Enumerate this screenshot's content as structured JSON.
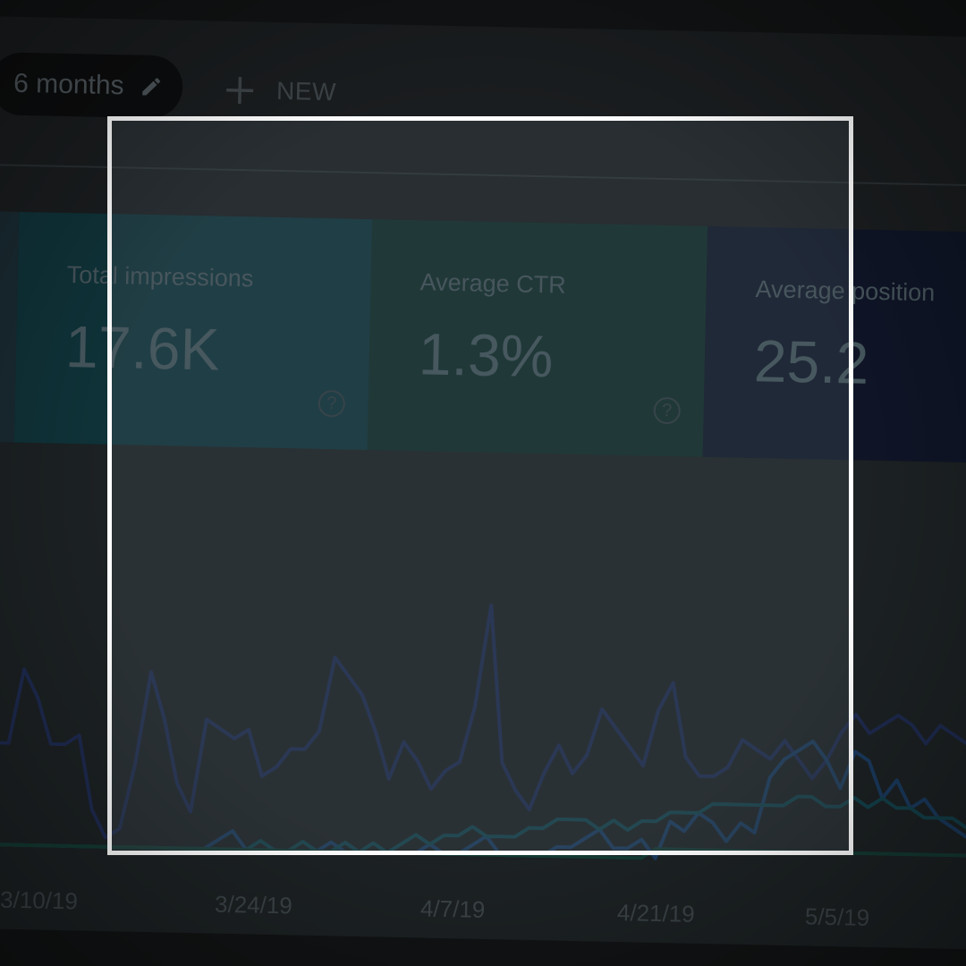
{
  "toolbar": {
    "date_filter_label": "6 months",
    "new_label": "NEW"
  },
  "cards": [
    {
      "title": "",
      "value": ""
    },
    {
      "title": "Total impressions",
      "value": "17.6K"
    },
    {
      "title": "Average CTR",
      "value": "1.3%"
    },
    {
      "title": "Average position",
      "value": "25.2"
    }
  ],
  "colors": {
    "impressions": "#1c2a4f",
    "ctr": "#13404a",
    "position": "#143a33",
    "series_blue": "#1a3a5e"
  },
  "chart_data": {
    "type": "line",
    "x_tick_labels": [
      "3/10/19",
      "3/24/19",
      "4/7/19",
      "4/21/19",
      "5/5/19"
    ],
    "series": [
      {
        "color": "#1e2a4f",
        "values": [
          12,
          12,
          20,
          17,
          12,
          12,
          13,
          5,
          2,
          3,
          10,
          20,
          15,
          8,
          5,
          15,
          14,
          13,
          14,
          9,
          10,
          12,
          12,
          14,
          22,
          20,
          18,
          14,
          9,
          13,
          11,
          8,
          10,
          11,
          17,
          28,
          11,
          8,
          6,
          10,
          13,
          10,
          12,
          17,
          15,
          13,
          11,
          17,
          20,
          12,
          10,
          10,
          11,
          14,
          13,
          12,
          14,
          12,
          10,
          12,
          15,
          17,
          15,
          16,
          17,
          16,
          14,
          16,
          15,
          14,
          12,
          11
        ]
      },
      {
        "color": "#1a3a5e",
        "values": [
          1,
          1,
          1,
          1,
          1,
          1,
          1,
          1,
          1,
          1,
          1,
          1,
          1,
          1,
          1,
          1,
          2,
          3,
          1,
          1,
          1,
          1,
          1,
          1,
          2,
          1,
          1,
          1,
          1,
          1,
          1,
          2,
          1,
          1,
          2,
          3,
          1,
          1,
          1,
          1,
          2,
          2,
          3,
          4,
          2,
          2,
          3,
          1,
          5,
          4,
          6,
          5,
          3,
          5,
          4,
          10,
          12,
          13,
          14,
          12,
          9,
          13,
          12,
          8,
          10,
          7,
          8,
          6,
          5,
          4,
          5,
          3
        ]
      },
      {
        "color": "#13404a",
        "values": [
          1,
          1,
          1,
          1,
          1,
          1,
          1,
          1,
          1,
          1,
          1,
          1,
          1,
          1,
          1,
          1,
          1,
          1,
          1,
          2,
          1,
          1,
          2,
          1,
          1,
          2,
          1,
          2,
          1,
          2,
          3,
          2,
          3,
          3,
          4,
          3,
          3,
          3,
          4,
          4,
          5,
          5,
          5,
          4,
          5,
          4,
          5,
          5,
          6,
          6,
          6,
          7,
          7,
          7,
          7,
          7,
          7,
          8,
          8,
          7,
          7,
          8,
          7,
          8,
          7,
          7,
          6,
          6,
          6,
          5,
          5,
          5
        ]
      },
      {
        "color": "#143a33",
        "values": [
          1,
          1,
          1,
          1,
          1,
          1,
          1,
          1,
          1,
          1,
          1,
          1,
          1,
          1,
          1,
          1,
          1,
          1,
          1,
          1,
          1,
          1,
          1,
          1,
          1,
          1,
          1,
          1,
          1,
          1,
          1,
          1,
          1,
          1,
          1,
          1,
          1,
          1,
          1,
          1,
          1,
          1,
          1,
          1,
          1,
          1,
          1,
          2,
          2,
          2,
          2,
          2,
          2,
          2,
          2,
          2,
          2,
          2,
          2,
          2,
          2,
          2,
          2,
          2,
          2,
          2,
          2,
          2,
          2,
          2,
          2,
          2
        ]
      }
    ]
  }
}
